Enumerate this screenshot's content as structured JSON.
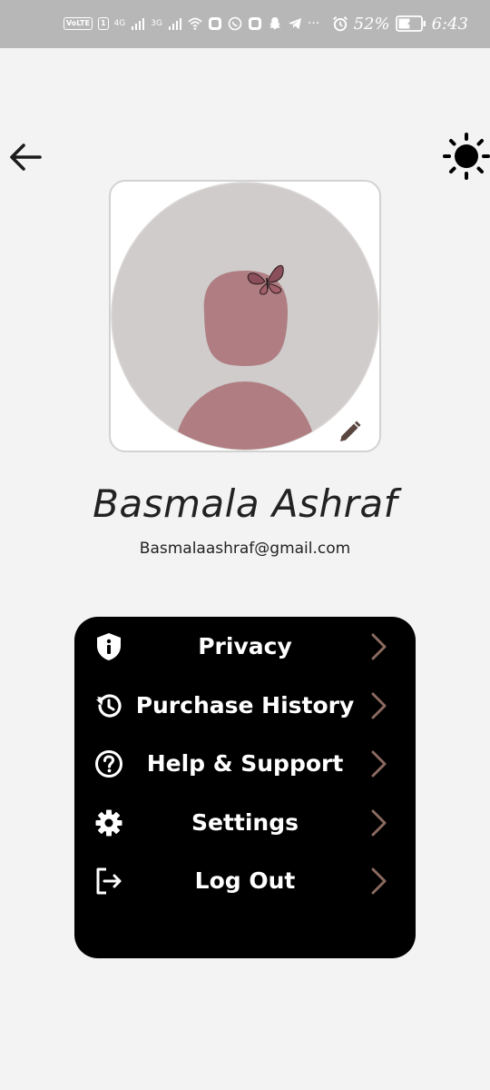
{
  "status_bar": {
    "volte": "VoLTE",
    "sim1": "1",
    "net1": "4G",
    "net2": "3G",
    "more": "···",
    "battery_percent": "52%",
    "time": "6:43",
    "battery_level": 0.52,
    "icons": [
      "signal-icon",
      "wifi-icon",
      "app-notification-icon",
      "whatsapp-icon",
      "snapchat-icon",
      "telegram-icon",
      "alarm-icon",
      "battery-icon"
    ]
  },
  "header": {
    "back_icon": "arrow-left-icon",
    "theme_icon": "sun-icon"
  },
  "profile": {
    "name": "Basmala Ashraf",
    "email": "Basmalaashraf@gmail.com",
    "edit_icon": "pencil-icon"
  },
  "menu": {
    "items": [
      {
        "label": "Privacy",
        "icon": "shield-info-icon"
      },
      {
        "label": "Purchase History",
        "icon": "history-icon"
      },
      {
        "label": "Help & Support",
        "icon": "help-circle-icon"
      },
      {
        "label": "Settings",
        "icon": "gear-icon"
      },
      {
        "label": "Log Out",
        "icon": "logout-icon"
      }
    ]
  },
  "colors": {
    "background": "#f3f3f3",
    "status_bar": "#b7b7b7",
    "menu_background": "#000000",
    "chevron": "#8b6a60",
    "avatar_background": "#cfcccb",
    "avatar_figure": "#b07e82"
  }
}
